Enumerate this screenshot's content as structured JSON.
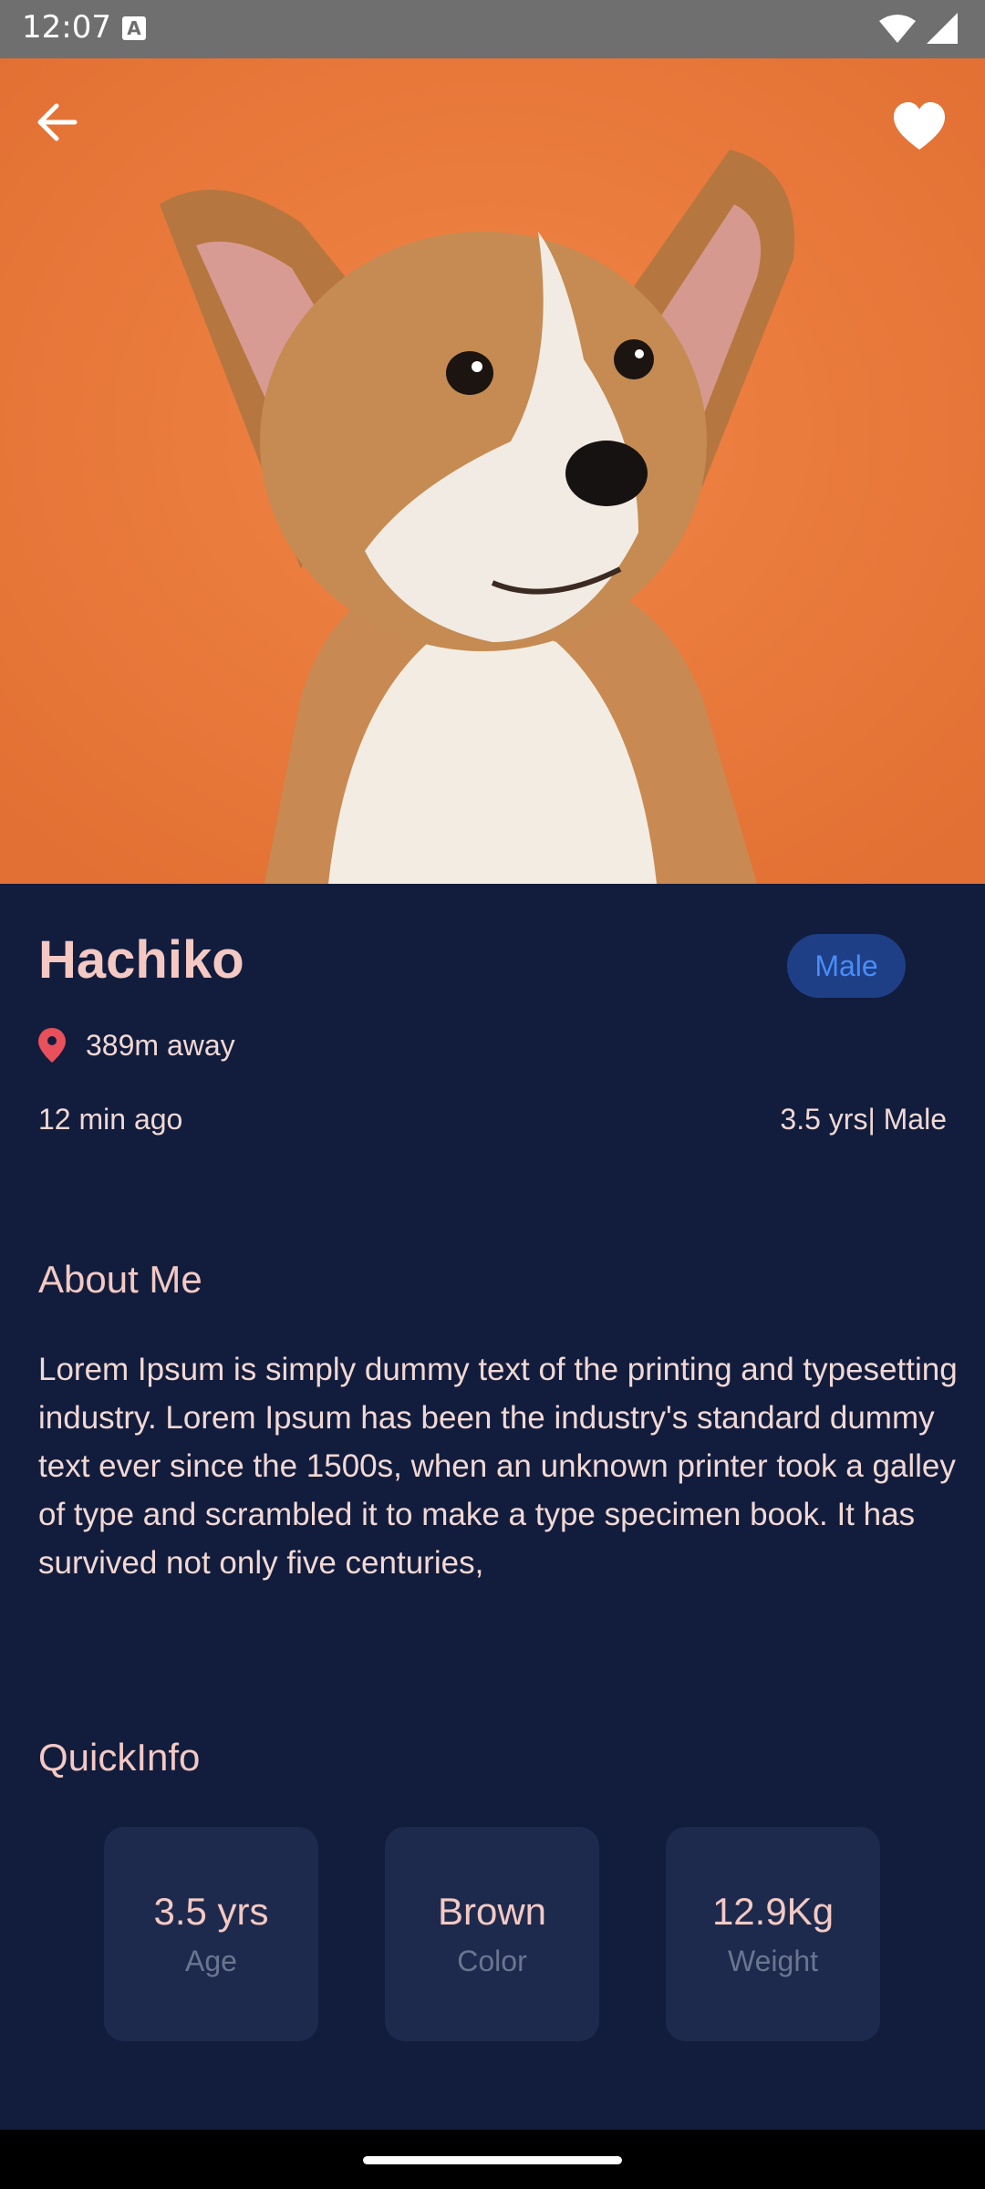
{
  "status_bar": {
    "time": "12:07",
    "icons": [
      "a-icon",
      "wifi-icon",
      "signal-icon"
    ]
  },
  "hero": {
    "image": "corgi-puppy-photo",
    "background_color": "#ea7a3f",
    "back_icon": "arrow-left-icon",
    "favorite_icon": "heart-icon"
  },
  "pet": {
    "name": "Hachiko",
    "gender_badge": "Male",
    "distance": "389m away",
    "posted": "12 min ago",
    "age_gender": "3.5 yrs| Male"
  },
  "about": {
    "title": "About Me",
    "text": "Lorem Ipsum is simply dummy text of the printing and typesetting industry. Lorem Ipsum has been the industry's standard dummy text ever since the 1500s, when an unknown printer took a galley of type and scrambled it to make a type specimen book. It has survived not only five centuries,"
  },
  "quick_info": {
    "title": "QuickInfo",
    "cards": [
      {
        "value": "3.5 yrs",
        "label": "Age"
      },
      {
        "value": "Brown",
        "label": "Color"
      },
      {
        "value": "12.9Kg",
        "label": "Weight"
      }
    ]
  },
  "colors": {
    "background": "#121d3d",
    "accent_text": "#f4c9c3",
    "badge_text": "#4a8df7",
    "pin": "#e8505b"
  }
}
